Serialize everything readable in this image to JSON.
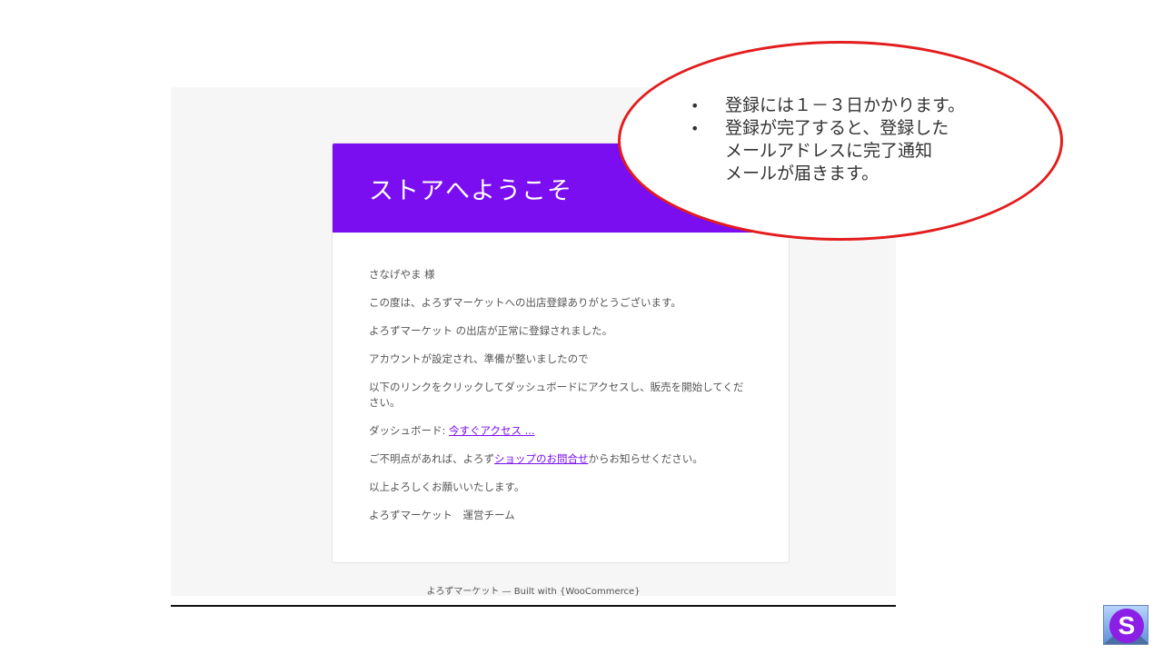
{
  "email": {
    "title": "ストアへようこそ",
    "greeting": "さなげやま 様",
    "line1": "この度は、よろずマーケットへの出店登録ありがとうございます。",
    "line2": "よろずマーケット の出店が正常に登録されました。",
    "line3": "アカウントが設定され、準備が整いましたので",
    "line4": "以下のリンクをクリックしてダッシュボードにアクセスし、販売を開始してください。",
    "dashboard_label": "ダッシュボード: ",
    "dashboard_link": "今すぐアクセス ...",
    "contact_prefix": "ご不明点があれば、よろず",
    "contact_link": "ショップのお問合せ",
    "contact_suffix": "からお知らせください。",
    "closing": "以上よろしくお願いいたします。",
    "signature": "よろずマーケット　運営チーム",
    "footer": "よろずマーケット — Built with {WooCommerce}",
    "accent_color": "#7a0ef0"
  },
  "callout": {
    "items": [
      "登録には１－３日かかります。",
      "登録が完了すると、登録した\nメールアドレスに完了通知\nメールが届きます。"
    ],
    "border_color": "#e31c1c"
  },
  "logo": {
    "letter": "S",
    "icon": "logo-s-icon"
  }
}
